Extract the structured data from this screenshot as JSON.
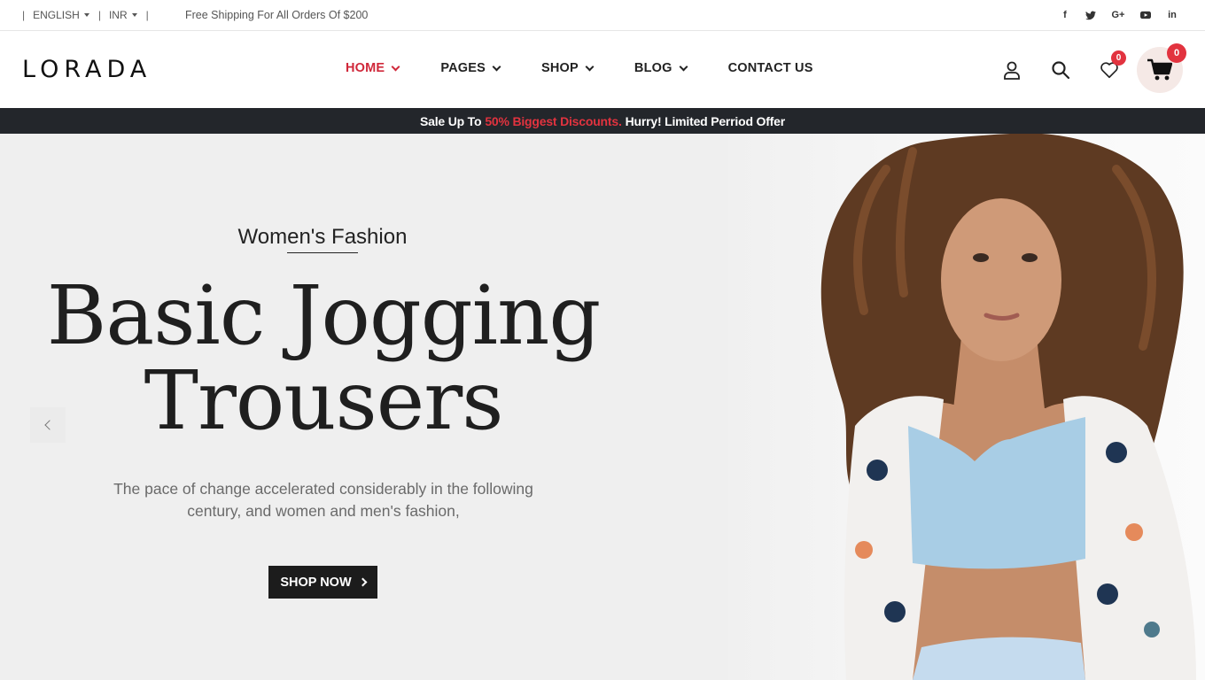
{
  "topbar": {
    "language": "ENGLISH",
    "currency": "INR",
    "shipping_text": "Free Shipping For All Orders Of $200",
    "social": [
      "facebook-icon",
      "twitter-icon",
      "google-plus-icon",
      "youtube-icon",
      "linkedin-icon"
    ],
    "social_glyphs": {
      "facebook": "f",
      "google": "G+",
      "linkedin": "in"
    }
  },
  "header": {
    "logo": "LORADA",
    "nav": [
      {
        "label": "HOME",
        "active": true,
        "dropdown": true
      },
      {
        "label": "PAGES",
        "active": false,
        "dropdown": true
      },
      {
        "label": "SHOP",
        "active": false,
        "dropdown": true
      },
      {
        "label": "BLOG",
        "active": false,
        "dropdown": true
      },
      {
        "label": "CONTACT US",
        "active": false,
        "dropdown": false
      }
    ],
    "wishlist_count": "0",
    "cart_count": "0"
  },
  "promo": {
    "prefix": "Sale Up To",
    "highlight": "50% Biggest Discounts.",
    "suffix": "Hurry! Limited Perriod Offer"
  },
  "hero": {
    "subtitle": "Women's Fashion",
    "title_line1": "Basic Jogging",
    "title_line2": "Trousers",
    "description_line1": "The pace of change accelerated considerably in the following",
    "description_line2": "century, and women and men's fashion,",
    "button_label": "SHOP NOW"
  },
  "colors": {
    "accent": "#d0283a",
    "badge": "#e2333f",
    "promo_bg": "#23262b"
  }
}
